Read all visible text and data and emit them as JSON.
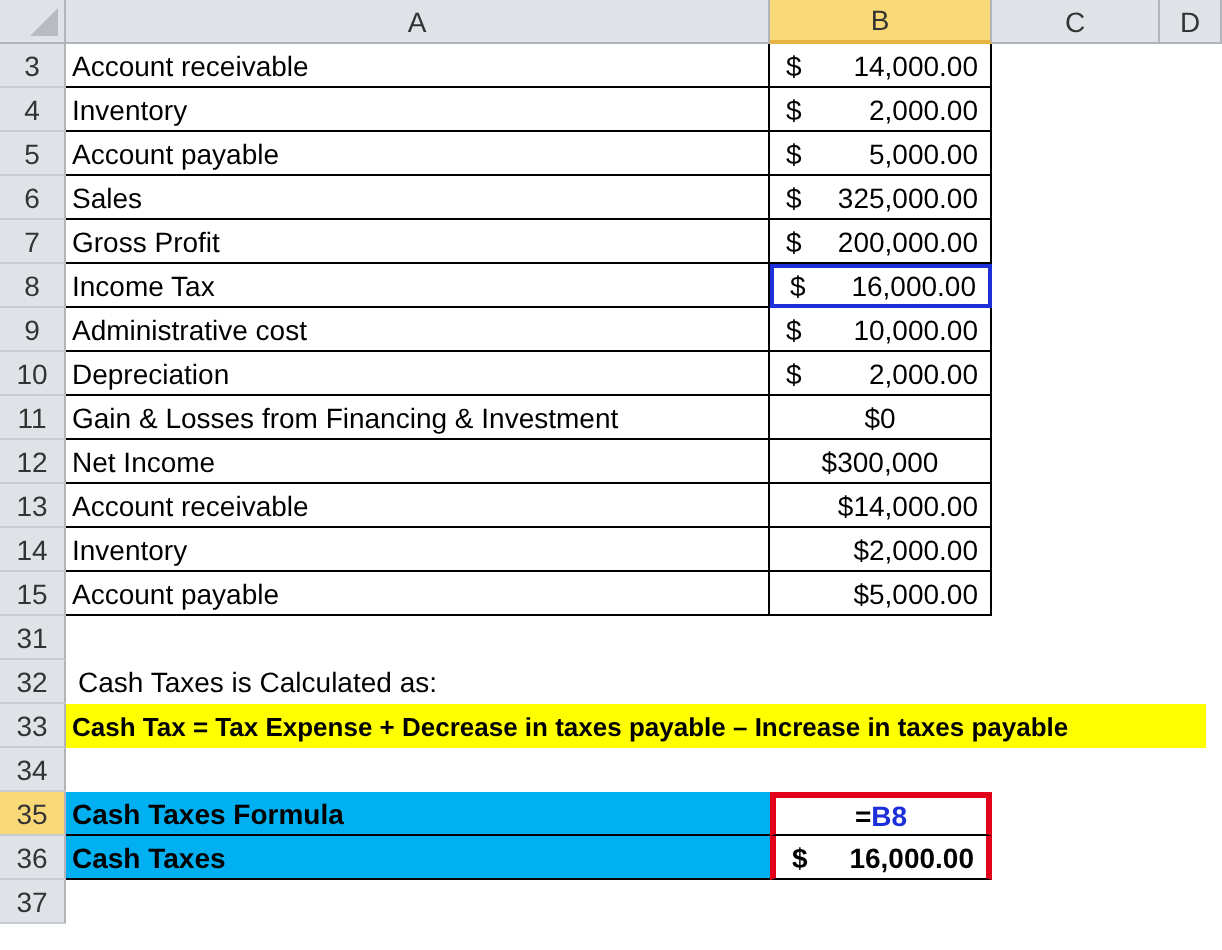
{
  "columns": [
    {
      "label": "A",
      "selected": false
    },
    {
      "label": "B",
      "selected": true
    },
    {
      "label": "C",
      "selected": false
    },
    {
      "label": "D",
      "selected": false
    }
  ],
  "rows": [
    {
      "number": "3",
      "selected": false,
      "kind": "item",
      "label": "Account receivable",
      "value": {
        "kind": "accounting",
        "symbol": "$",
        "amount": "14,000.00"
      }
    },
    {
      "number": "4",
      "selected": false,
      "kind": "item",
      "label": "Inventory",
      "value": {
        "kind": "accounting",
        "symbol": "$",
        "amount": "2,000.00"
      }
    },
    {
      "number": "5",
      "selected": false,
      "kind": "item",
      "label": "Account payable",
      "value": {
        "kind": "accounting",
        "symbol": "$",
        "amount": "5,000.00"
      }
    },
    {
      "number": "6",
      "selected": false,
      "kind": "item",
      "label": "Sales",
      "value": {
        "kind": "accounting",
        "symbol": "$",
        "amount": "325,000.00"
      }
    },
    {
      "number": "7",
      "selected": false,
      "kind": "item",
      "label": "Gross Profit",
      "value": {
        "kind": "accounting",
        "symbol": "$",
        "amount": "200,000.00"
      }
    },
    {
      "number": "8",
      "selected": false,
      "kind": "item",
      "label": "Income Tax",
      "referenced": true,
      "value": {
        "kind": "accounting",
        "symbol": "$",
        "amount": "16,000.00"
      }
    },
    {
      "number": "9",
      "selected": false,
      "kind": "item",
      "label": "Administrative cost",
      "value": {
        "kind": "accounting",
        "symbol": "$",
        "amount": "10,000.00"
      }
    },
    {
      "number": "10",
      "selected": false,
      "kind": "item",
      "label": "Depreciation",
      "value": {
        "kind": "accounting",
        "symbol": "$",
        "amount": "2,000.00"
      }
    },
    {
      "number": "11",
      "selected": false,
      "kind": "item",
      "label": "Gain & Losses from Financing & Investment",
      "value": {
        "kind": "center",
        "text": "$0"
      }
    },
    {
      "number": "12",
      "selected": false,
      "kind": "item",
      "label": "Net Income",
      "value": {
        "kind": "center",
        "text": "$300,000"
      }
    },
    {
      "number": "13",
      "selected": false,
      "kind": "item",
      "label": "Account receivable",
      "value": {
        "kind": "right",
        "text": "$14,000.00"
      }
    },
    {
      "number": "14",
      "selected": false,
      "kind": "item",
      "label": "Inventory",
      "value": {
        "kind": "right",
        "text": "$2,000.00"
      }
    },
    {
      "number": "15",
      "selected": false,
      "kind": "item",
      "label": "Account payable",
      "value": {
        "kind": "right",
        "text": "$5,000.00"
      }
    },
    {
      "number": "31",
      "selected": false,
      "kind": "blank"
    },
    {
      "number": "32",
      "selected": false,
      "kind": "note",
      "text": "Cash Taxes is Calculated as:"
    },
    {
      "number": "33",
      "selected": false,
      "kind": "banner",
      "text": "Cash Tax = Tax Expense + Decrease in taxes payable – Increase in taxes payable"
    },
    {
      "number": "34",
      "selected": false,
      "kind": "blank"
    },
    {
      "number": "35",
      "selected": true,
      "kind": "result",
      "label": "Cash Taxes Formula",
      "outlined": true,
      "value": {
        "kind": "formula",
        "sign": "=",
        "reference": "B8"
      }
    },
    {
      "number": "36",
      "selected": false,
      "kind": "result",
      "label": "Cash Taxes",
      "outlined": true,
      "value": {
        "kind": "accounting",
        "symbol": "$",
        "amount": "16,000.00"
      }
    },
    {
      "number": "37",
      "selected": false,
      "kind": "blank"
    }
  ]
}
